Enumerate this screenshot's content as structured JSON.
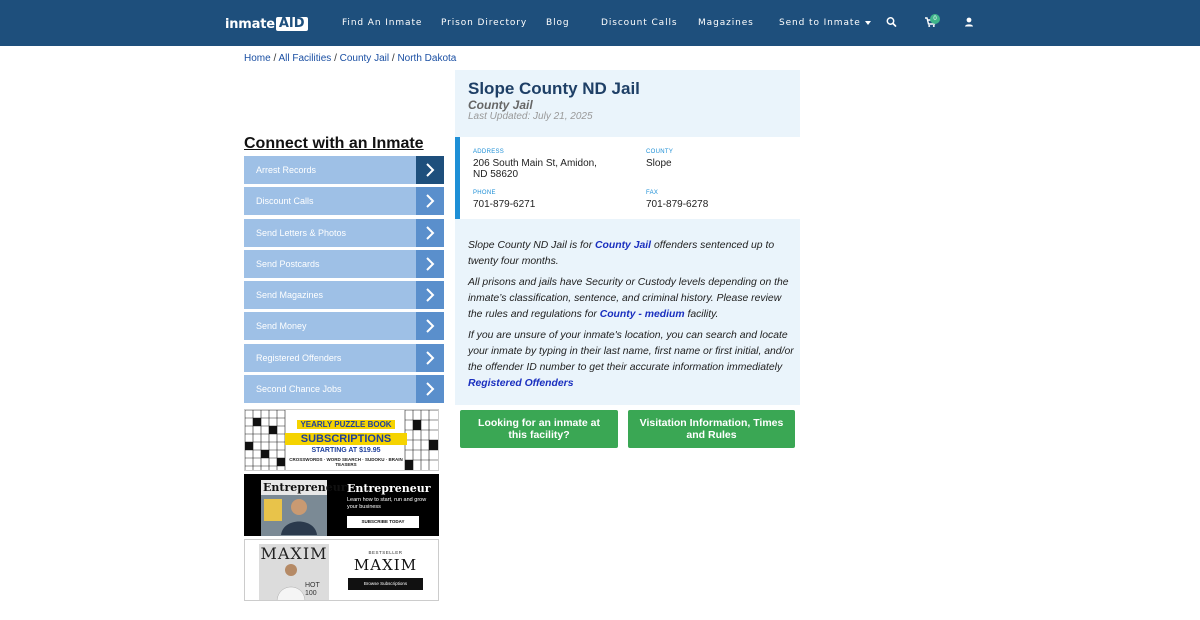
{
  "header": {
    "logo_part1": "inmate",
    "logo_part2": "AID",
    "nav": [
      "Find An Inmate",
      "Prison Directory",
      "Blog",
      "Discount Calls",
      "Magazines",
      "Send to Inmate"
    ],
    "cart_count": "0",
    "icons": [
      "search-icon",
      "cart-icon",
      "user-icon"
    ],
    "bar_color": "#1e4f7c"
  },
  "breadcrumb": {
    "items": [
      "Home",
      "All Facilities",
      "County Jail",
      "North Dakota"
    ],
    "separator": "/"
  },
  "sidebar": {
    "heading": "Connect with an Inmate",
    "items": [
      {
        "label": "Arrest Records"
      },
      {
        "label": "Discount Calls"
      },
      {
        "label": "Send Letters & Photos"
      },
      {
        "label": "Send Postcards"
      },
      {
        "label": "Send Magazines"
      },
      {
        "label": "Send Money"
      },
      {
        "label": "Registered Offenders"
      },
      {
        "label": "Second Chance Jobs"
      }
    ],
    "ads": {
      "puzzle": {
        "line1": "YEARLY PUZZLE BOOK",
        "line2": "SUBSCRIPTIONS",
        "line3": "STARTING AT $19.95",
        "line4": "CROSSWORDS · WORD SEARCH · SUDOKU · BRAIN TEASERS"
      },
      "entrepreneur": {
        "brand": "Entrepreneur",
        "tagline": "Learn how to start, run and grow your business",
        "cta": "SUBSCRIBE TODAY"
      },
      "maxim": {
        "brand": "MAXIM",
        "kicker": "BESTSELLER",
        "cta": "Browse Subscriptions",
        "cover_text": "HOT 100"
      }
    }
  },
  "facility": {
    "title": "Slope County ND Jail",
    "type": "County Jail",
    "updated": "Last Updated: July 21, 2025",
    "address_label": "ADDRESS",
    "address_line1": "206 South Main St, Amidon,",
    "address_line2": "ND 58620",
    "county_label": "COUNTY",
    "county": "Slope",
    "phone_label": "PHONE",
    "phone": "701-879-6271",
    "fax_label": "FAX",
    "fax": "701-879-6278",
    "p1_a": "Slope County ND Jail is for ",
    "p1_link": "County Jail",
    "p1_b": " offenders sentenced up to twenty four months.",
    "p2_a": "All prisons and jails have Security or Custody levels depending on the inmate’s classification, sentence, and criminal history. Please review the rules and regulations for ",
    "p2_link": "County - medium",
    "p2_b": " facility.",
    "p3_a": "If you are unsure of your inmate's location, you can search and locate your inmate by typing in their last name, first name or first initial, and/or the offender ID number to get their accurate information immediately",
    "p3_link": "Registered Offenders"
  },
  "buttons": {
    "lookup": "Looking for an inmate at this facility?",
    "visitation": "Visitation Information, Times and Rules"
  }
}
